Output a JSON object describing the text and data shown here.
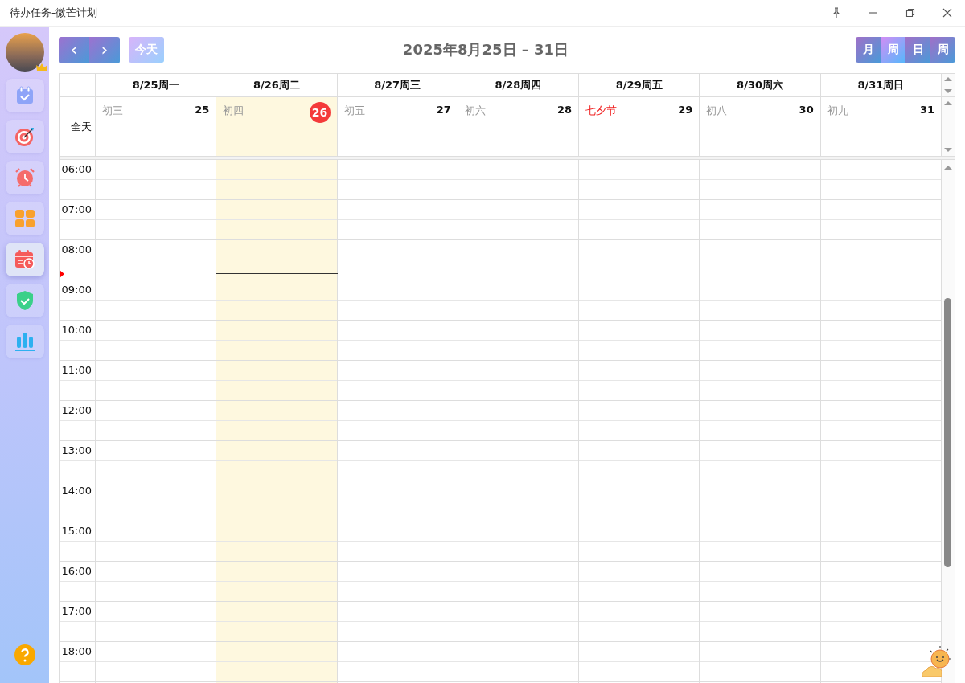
{
  "window": {
    "title": "待办任务-微芒计划"
  },
  "sidebar": {
    "items": [
      {
        "kind": "todo",
        "selected": false
      },
      {
        "kind": "target",
        "selected": false
      },
      {
        "kind": "alarm",
        "selected": false
      },
      {
        "kind": "grid",
        "selected": false
      },
      {
        "kind": "calendar",
        "selected": true
      },
      {
        "kind": "shield",
        "selected": false
      },
      {
        "kind": "stats",
        "selected": false
      }
    ]
  },
  "toolbar": {
    "prev": "‹",
    "next": "›",
    "today_button": "今天",
    "range_title": "2025年8月25日 – 31日",
    "views": [
      {
        "label": "月",
        "selected": false
      },
      {
        "label": "周",
        "selected": true
      },
      {
        "label": "日",
        "selected": false
      },
      {
        "label": "周",
        "selected": false
      }
    ]
  },
  "calendar": {
    "all_day_label": "全天",
    "days": [
      {
        "header": "8/25周一",
        "lunar": "初三",
        "date": "25",
        "today": false,
        "holiday": false
      },
      {
        "header": "8/26周二",
        "lunar": "初四",
        "date": "26",
        "today": true,
        "holiday": false
      },
      {
        "header": "8/27周三",
        "lunar": "初五",
        "date": "27",
        "today": false,
        "holiday": false
      },
      {
        "header": "8/28周四",
        "lunar": "初六",
        "date": "28",
        "today": false,
        "holiday": false
      },
      {
        "header": "8/29周五",
        "lunar": "七夕节",
        "date": "29",
        "today": false,
        "holiday": true
      },
      {
        "header": "8/30周六",
        "lunar": "初八",
        "date": "30",
        "today": false,
        "holiday": false
      },
      {
        "header": "8/31周日",
        "lunar": "初九",
        "date": "31",
        "today": false,
        "holiday": false
      }
    ],
    "hours": [
      "06:00",
      "07:00",
      "08:00",
      "09:00",
      "10:00",
      "11:00",
      "12:00",
      "13:00",
      "14:00",
      "15:00",
      "16:00",
      "17:00",
      "18:00"
    ]
  }
}
